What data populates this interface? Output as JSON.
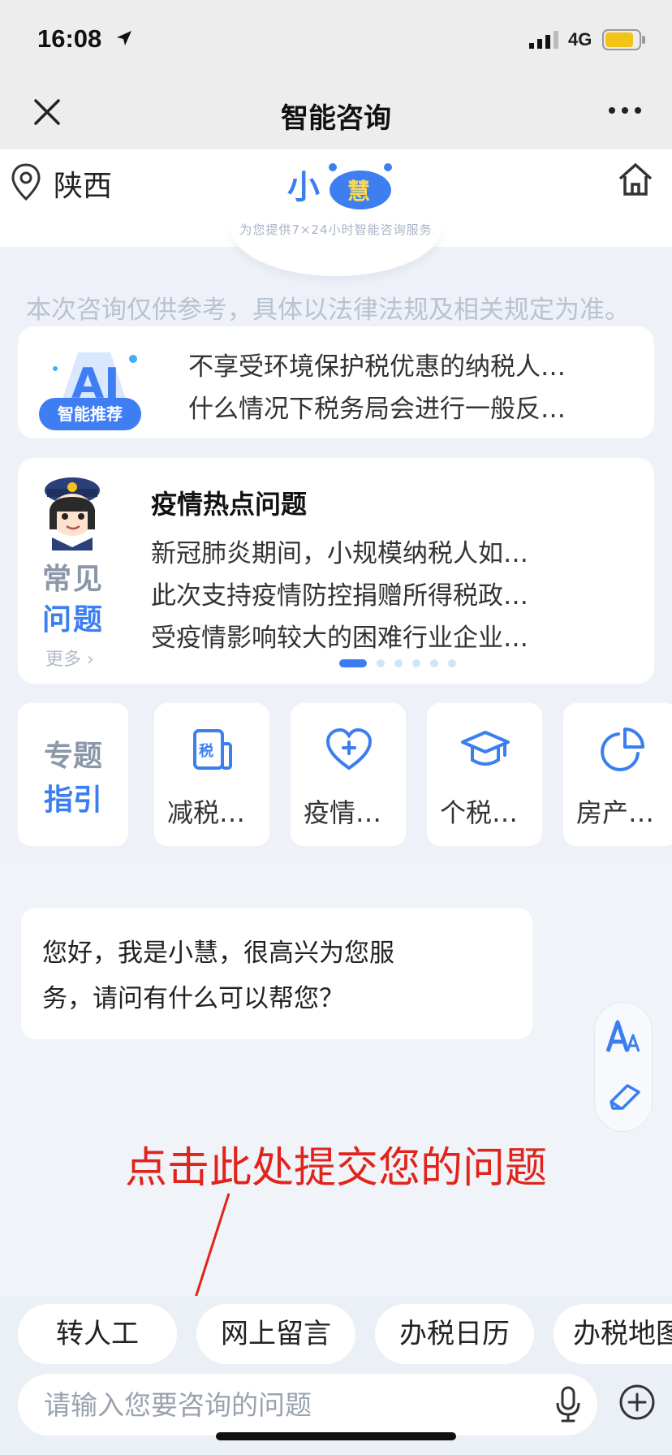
{
  "status_bar": {
    "time": "16:08",
    "network": "4G"
  },
  "nav": {
    "title": "智能咨询"
  },
  "header": {
    "location": "陕西",
    "logo_text_1": "小",
    "logo_text_2": "慧",
    "tagline": "为您提供7×24小时智能咨询服务"
  },
  "disclaimer": "本次咨询仅供参考，具体以法律法规及相关规定为准。",
  "ai_recommend": {
    "badge_main": "AI",
    "badge_label": "智能推荐",
    "items": [
      "不享受环境保护税优惠的纳税人…",
      "什么情况下税务局会进行一般反…"
    ]
  },
  "faq": {
    "side_label_1": "常见",
    "side_label_2": "问题",
    "more": "更多",
    "title": "疫情热点问题",
    "items": [
      "新冠肺炎期间，小规模纳税人如…",
      "此次支持疫情防控捐赠所得税政…",
      "受疫情影响较大的困难行业企业…"
    ],
    "pages": 6,
    "current_page": 1
  },
  "topics": {
    "guide_1": "专题",
    "guide_2": "指引",
    "items": [
      {
        "label": "减税…",
        "icon": "tax-doc-icon",
        "icon_text": "税"
      },
      {
        "label": "疫情…",
        "icon": "heart-plus-icon"
      },
      {
        "label": "个税…",
        "icon": "graduation-cap-icon"
      },
      {
        "label": "房产…",
        "icon": "pie-chart-icon"
      }
    ]
  },
  "chat": {
    "greeting_lines": [
      "您好，我是小慧，很高兴为您服",
      "务，请问有什么可以帮您？"
    ]
  },
  "hint": "点击此处提交您的问题",
  "quick_actions": [
    "转人工",
    "网上留言",
    "办税日历",
    "办税地图"
  ],
  "input": {
    "placeholder": "请输入您要咨询的问题",
    "value": ""
  },
  "colors": {
    "accent": "#3c7ef0",
    "hint_red": "#e0241b",
    "background": "#eef2f8"
  }
}
